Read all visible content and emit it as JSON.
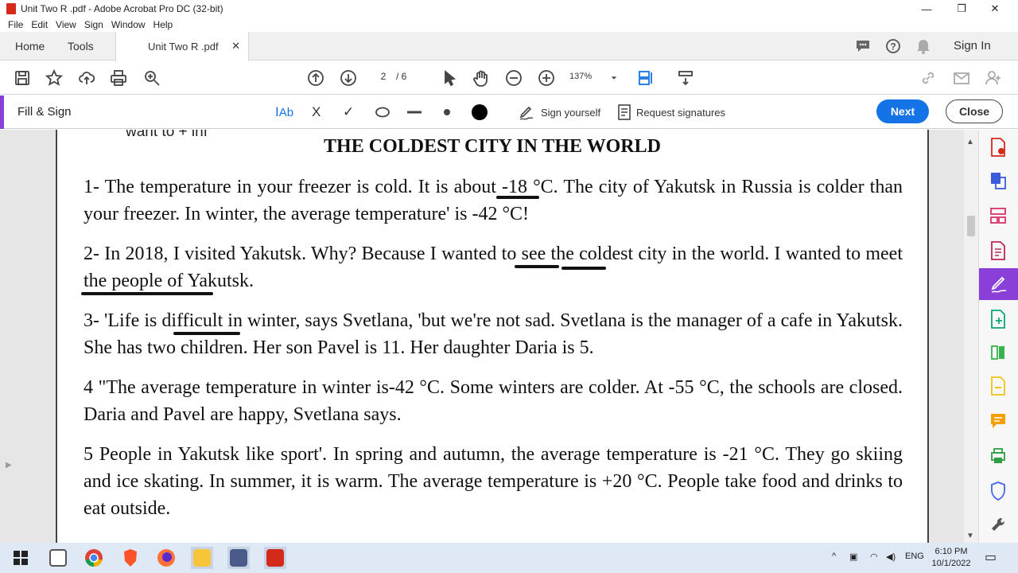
{
  "window": {
    "title": "Unit Two R .pdf - Adobe Acrobat Pro DC (32-bit)",
    "minimize": "—",
    "restore": "❐",
    "close": "✕"
  },
  "menu": [
    "File",
    "Edit",
    "View",
    "Sign",
    "Window",
    "Help"
  ],
  "tabs": {
    "home": "Home",
    "tools": "Tools",
    "document": "Unit Two R .pdf",
    "document_close": "✕",
    "sign_in": "Sign In"
  },
  "toolbar": {
    "page_current": "2",
    "page_total": "/ 6",
    "zoom": "137%"
  },
  "fill_sign": {
    "title": "Fill & Sign",
    "text_tool": "Ab",
    "cross": "X",
    "check": "✓",
    "sign_yourself": "Sign yourself",
    "request_signatures": "Request signatures",
    "next": "Next",
    "close": "Close"
  },
  "document": {
    "cut_off_top": "want to + inf",
    "title": "THE COLDEST CITY IN THE WORLD",
    "paragraphs": [
      "1- The temperature in your freezer is cold. It is about -18 °C. The city of Yakutsk in Russia is colder than your freezer. In winter, the average temperature' is -42 °C!",
      "2- In 2018, I visited Yakutsk. Why? Because I wanted to see the coldest city in the world. I wanted to meet the people of Yakutsk.",
      "3- 'Life is difficult in winter, says Svetlana, 'but we're not sad. Svetlana is the manager of a cafe in Yakutsk. She has two children. Her son Pavel is 11. Her daughter Daria is 5.",
      "4 \"The average temperature in winter is-42 °C. Some winters are colder. At -55 °C, the schools are closed. Daria and Pavel are happy, Svetlana says.",
      "5 People in Yakutsk like sport'. In spring and autumn, the average temperature is -21 °C. They go skiing and ice skating. In summer, it is warm. The average temperature is +20 °C. People take food and drinks to eat outside."
    ]
  },
  "taskbar": {
    "lang": "ENG",
    "time": "6:10 PM",
    "date": "10/1/2022"
  },
  "colors": {
    "accent_purple": "#8b3fd9",
    "next_blue": "#1473e6",
    "acrobat_red": "#d42a1c"
  }
}
